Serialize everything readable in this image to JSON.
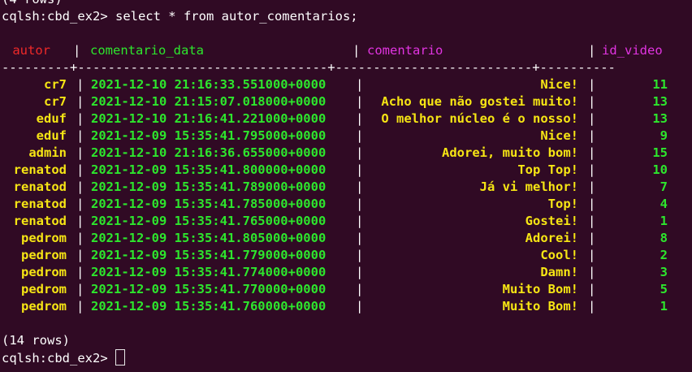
{
  "terminal": {
    "prev_output": "(4 rows)",
    "prompt": "cqlsh:cbd_ex2> ",
    "command": "select * from autor_comentarios;",
    "divider": "---------+---------------------------------+--------------------------+----------",
    "rows_count": "(14 rows)",
    "final_prompt": "cqlsh:cbd_ex2> "
  },
  "table": {
    "columns": [
      "autor",
      "comentario_data",
      "comentario",
      "id_video"
    ],
    "column_colors": {
      "autor": "#ef2929",
      "comentario_data": "#2de62d",
      "comentario": "#e134e1",
      "id_video": "#e134e1"
    },
    "rows": [
      {
        "autor": "cr7",
        "comentario_data": "2021-12-10 21:16:33.551000+0000",
        "comentario": "Nice!",
        "id_video": "11"
      },
      {
        "autor": "cr7",
        "comentario_data": "2021-12-10 21:15:07.018000+0000",
        "comentario": "Acho que não gostei muito!",
        "id_video": "13"
      },
      {
        "autor": "eduf",
        "comentario_data": "2021-12-10 21:16:41.221000+0000",
        "comentario": "O melhor núcleo é o nosso!",
        "id_video": "13"
      },
      {
        "autor": "eduf",
        "comentario_data": "2021-12-09 15:35:41.795000+0000",
        "comentario": "Nice!",
        "id_video": "9"
      },
      {
        "autor": "admin",
        "comentario_data": "2021-12-10 21:16:36.655000+0000",
        "comentario": "Adorei, muito bom!",
        "id_video": "15"
      },
      {
        "autor": "renatod",
        "comentario_data": "2021-12-09 15:35:41.800000+0000",
        "comentario": "Top Top!",
        "id_video": "10"
      },
      {
        "autor": "renatod",
        "comentario_data": "2021-12-09 15:35:41.789000+0000",
        "comentario": "Já vi melhor!",
        "id_video": "7"
      },
      {
        "autor": "renatod",
        "comentario_data": "2021-12-09 15:35:41.785000+0000",
        "comentario": "Top!",
        "id_video": "4"
      },
      {
        "autor": "renatod",
        "comentario_data": "2021-12-09 15:35:41.765000+0000",
        "comentario": "Gostei!",
        "id_video": "1"
      },
      {
        "autor": "pedrom",
        "comentario_data": "2021-12-09 15:35:41.805000+0000",
        "comentario": "Adorei!",
        "id_video": "8"
      },
      {
        "autor": "pedrom",
        "comentario_data": "2021-12-09 15:35:41.779000+0000",
        "comentario": "Cool!",
        "id_video": "2"
      },
      {
        "autor": "pedrom",
        "comentario_data": "2021-12-09 15:35:41.774000+0000",
        "comentario": "Damn!",
        "id_video": "3"
      },
      {
        "autor": "pedrom",
        "comentario_data": "2021-12-09 15:35:41.770000+0000",
        "comentario": "Muito Bom!",
        "id_video": "5"
      },
      {
        "autor": "pedrom",
        "comentario_data": "2021-12-09 15:35:41.760000+0000",
        "comentario": "Muito Bom!",
        "id_video": "1"
      }
    ]
  }
}
